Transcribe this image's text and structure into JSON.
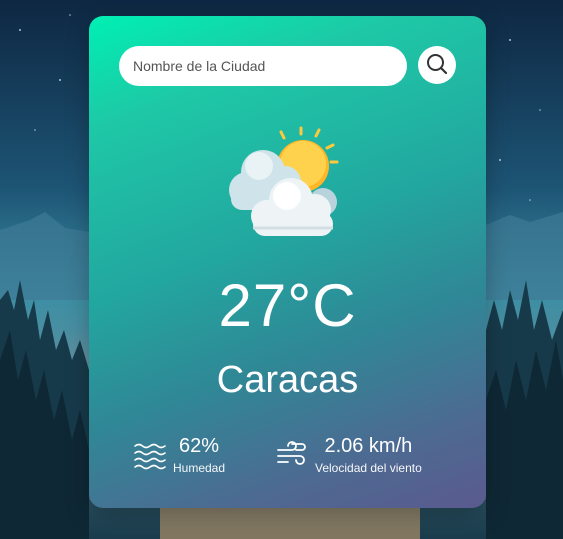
{
  "search": {
    "placeholder": "Nombre de la Ciudad",
    "value": ""
  },
  "weather": {
    "icon": "partly-cloudy-sun-icon",
    "temperature": "27°C",
    "city": "Caracas"
  },
  "details": {
    "humidity": {
      "value": "62%",
      "label": "Humedad",
      "icon": "waves-icon"
    },
    "wind": {
      "value": "2.06 km/h",
      "label": "Velocidad del viento",
      "icon": "wind-icon"
    }
  },
  "colors": {
    "card_top": "#00f0b4",
    "card_bottom": "#5a5a8e",
    "text": "#ffffff",
    "sun": "#ffc93c",
    "cloud": "#e6eef2"
  }
}
